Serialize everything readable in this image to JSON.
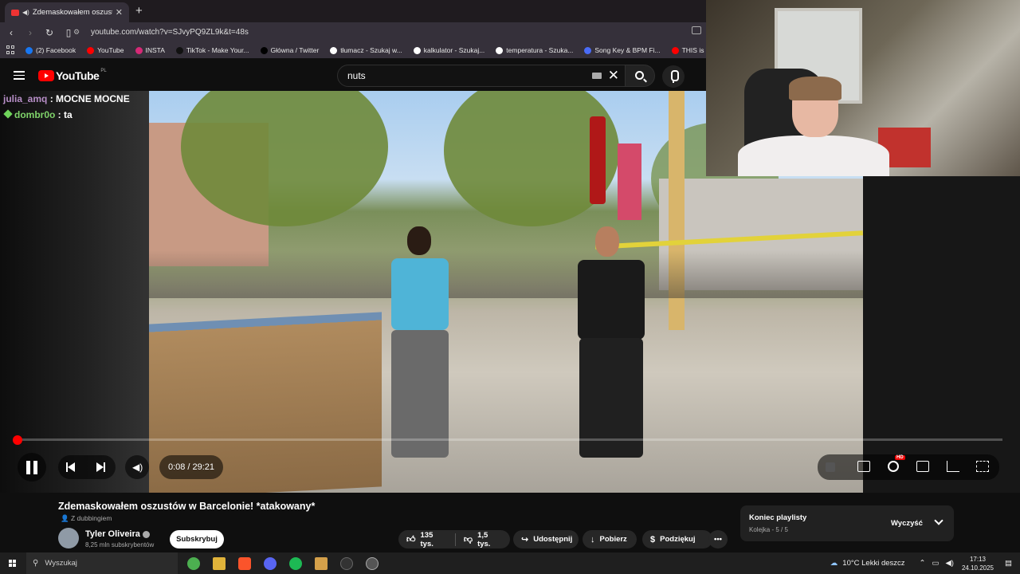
{
  "browser": {
    "tab_title": "Zdemaskowałem oszustów w",
    "url": "youtube.com/watch?v=SJvyPQ9ZL9k&t=48s",
    "bookmarks": [
      {
        "label": "(2) Facebook",
        "color": "#1877f2"
      },
      {
        "label": "YouTube",
        "color": "#ff0000"
      },
      {
        "label": "INSTA",
        "color": "#d62976"
      },
      {
        "label": "TikTok - Make Your...",
        "color": "#111111"
      },
      {
        "label": "Główna / Twitter",
        "color": "#000000"
      },
      {
        "label": "tłumacz - Szukaj w...",
        "color": "#ffffff"
      },
      {
        "label": "kalkulator - Szukaj...",
        "color": "#ffffff"
      },
      {
        "label": "temperatura - Szuka...",
        "color": "#ffffff"
      },
      {
        "label": "Song Key & BPM Fi...",
        "color": "#4a6cf7"
      },
      {
        "label": "THIS is WHY your",
        "color": "#ff0000"
      }
    ]
  },
  "youtube": {
    "logo_text": "YouTube",
    "logo_region": "PL",
    "search_query": "nuts"
  },
  "chat": [
    {
      "user": "julia_amq",
      "msg": "MOCNE MOCNE"
    },
    {
      "user": "dombr0o",
      "msg": "ta"
    }
  ],
  "player": {
    "time": "0:08 / 29:21",
    "progress_fraction": 0.0045,
    "hd_label": "HD"
  },
  "video": {
    "title": "Zdemaskowałem oszustów w Barcelonie! *atakowany*",
    "dubbing": "Z dubbingiem",
    "channel": "Tyler Oliveira",
    "subscribers": "8,25 mln subskrybentów",
    "subscribe_label": "Subskrybuj",
    "likes": "135 tys.",
    "dislikes": "1,5 tys.",
    "share": "Udostępnij",
    "download": "Pobierz",
    "thanks": "Podziękuj"
  },
  "playlist": {
    "title": "Koniec playlisty",
    "subtitle": "Kolejka - 5 / 5",
    "clear": "Wyczyść"
  },
  "taskbar": {
    "search_placeholder": "Wyszukaj",
    "weather": "10°C  Lekki deszcz",
    "time": "17:13",
    "date": "24.10.2025"
  }
}
